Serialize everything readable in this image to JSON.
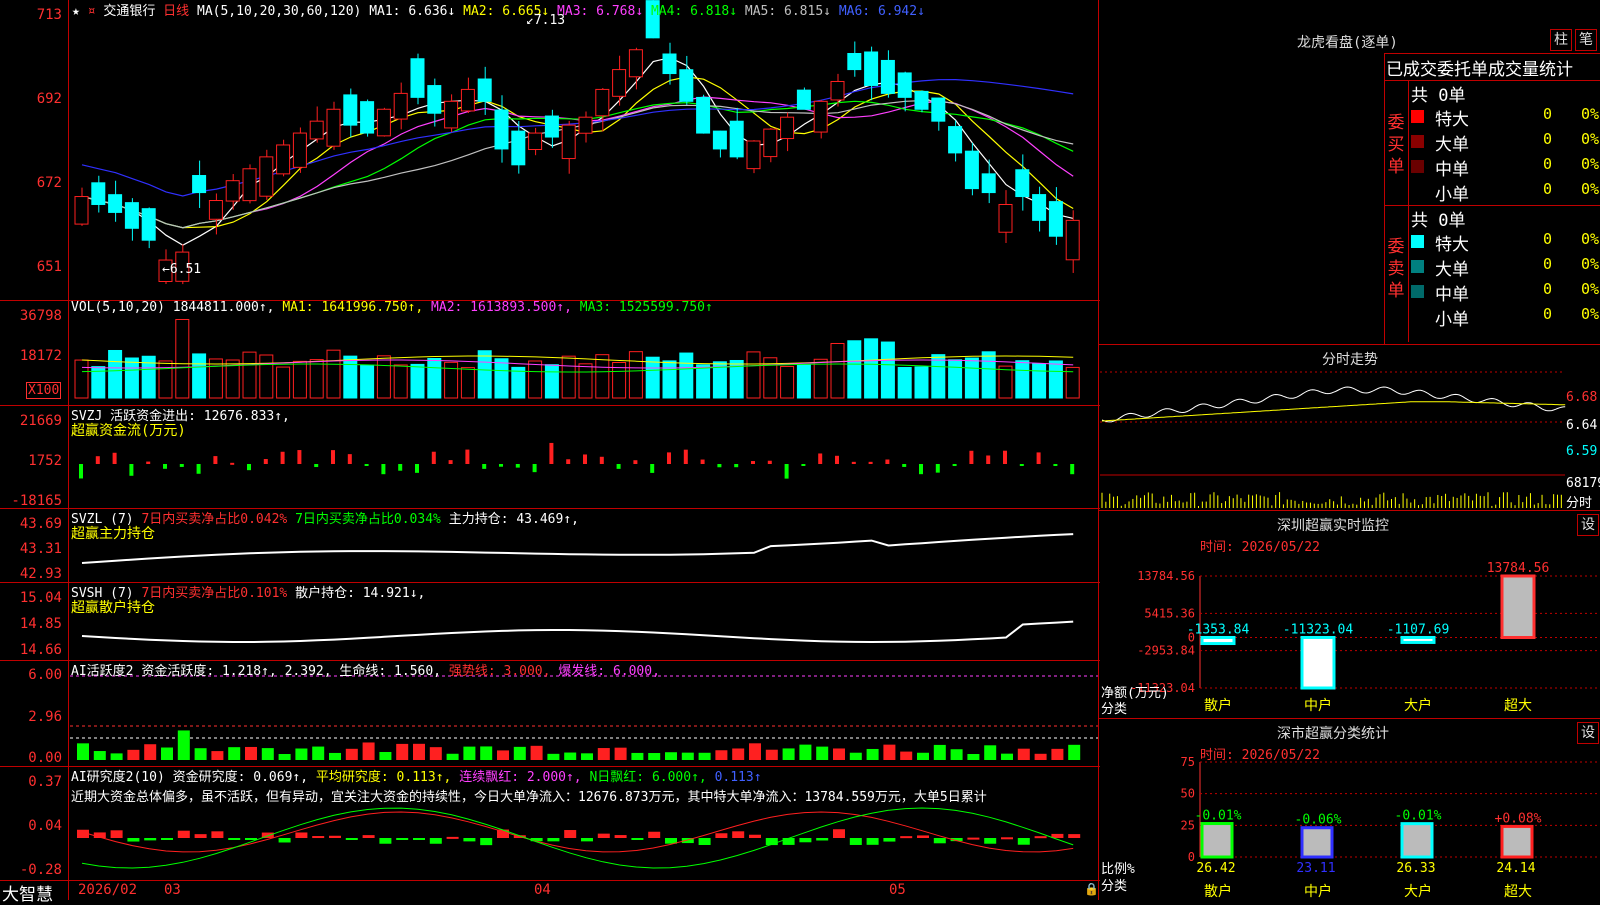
{
  "colors": {
    "up": "#ff2020",
    "down": "#00ffff",
    "bg": "#000000",
    "grid": "#c00000",
    "ma1": "#ffffff",
    "ma2": "#ffff00",
    "ma3": "#ff40ff",
    "ma4": "#00ff00",
    "ma5": "#c0c0c0",
    "ma6": "#3030ff"
  },
  "header": {
    "star": "★",
    "name": "交通银行",
    "period": "日线",
    "ma_label": "MA(5,10,20,30,60,120)",
    "ma1": "MA1: 6.636↓",
    "ma2": "MA2: 6.665↓",
    "ma3": "MA3: 6.768↓",
    "ma4": "MA4: 6.818↓",
    "ma5": "MA5: 6.815↓",
    "ma6": "MA6: 6.942↓"
  },
  "price_panel": {
    "y_ticks": [
      "713",
      "692",
      "672",
      "651"
    ],
    "high_label": "7.13",
    "low_label": "6.51"
  },
  "vol_panel": {
    "title": "VOL(5,10,20)",
    "value": "1844811.000↑,",
    "ma1": "MA1: 1641996.750↑,",
    "ma2": "MA2: 1613893.500↑,",
    "ma3": "MA3: 1525599.750↑",
    "y_ticks": [
      "36798",
      "18172"
    ],
    "unit": "X100"
  },
  "svzj_panel": {
    "title": "SVZJ",
    "line1": "活跃资金进出: 12676.833↑,",
    "line2": "超赢资金流(万元)",
    "y_ticks": [
      "21669",
      "1752",
      "-18165"
    ]
  },
  "svzl_panel": {
    "title": "SVZL (7)",
    "t1": "7日内买卖净占比0.042%",
    "t2": "7日内买卖净占比0.034%",
    "t3": "主力持仓: 43.469↑,",
    "line2": "超赢主力持仓",
    "y_ticks": [
      "43.69",
      "43.31",
      "42.93"
    ]
  },
  "svsh_panel": {
    "title": "SVSH (7)",
    "t1": "7日内买卖净占比0.101%",
    "t2": "散户持仓: 14.921↓,",
    "line2": "超赢散户持仓",
    "y_ticks": [
      "15.04",
      "14.85",
      "14.66"
    ]
  },
  "ai_active_panel": {
    "title": "AI活跃度2",
    "t1": "资金活跃度: 1.218↑,",
    "t2": "2.392,",
    "t3": "生命线: 1.560,",
    "t4": "强势线: 3.000,",
    "t5": "爆发线: 6.000,",
    "y_ticks": [
      "6.00",
      "2.96",
      "0.00"
    ]
  },
  "ai_research_panel": {
    "title": "AI研究度2(10)",
    "t1": "资金研究度: 0.069↑,",
    "t2": "平均研究度: 0.113↑,",
    "t3": "连续飘红: 2.000↑,",
    "t4": "N日飘红: 6.000↑,",
    "t5": "0.113↑",
    "note": "近期大资金总体偏多，虽不活跃，但有异动，宜关注大资金的持续性，今日大单净流入：12676.873万元，其中特大单净流入：13784.559万元，大单5日累计",
    "y_ticks": [
      "0.37",
      "0.04",
      "-0.28"
    ]
  },
  "x_axis": {
    "brand": "大智慧",
    "labels": [
      "2026/02",
      "03",
      "04",
      "05"
    ]
  },
  "lhb": {
    "title": "龙虎看盘(逐单)",
    "btn1": "柱",
    "btn2": "笔",
    "subtitle": "已成交委托单成交量统计",
    "buy_label": "委买单",
    "sell_label": "委卖单",
    "buy_total": "共 0单",
    "sell_total": "共 0单",
    "buy_rows": [
      {
        "label": "特大",
        "count": "0",
        "pct": "0%",
        "color": "#ff0000"
      },
      {
        "label": "大单",
        "count": "0",
        "pct": "0%",
        "color": "#8b0000"
      },
      {
        "label": "中单",
        "count": "0",
        "pct": "0%",
        "color": "#6a0000"
      },
      {
        "label": "小单",
        "count": "0",
        "pct": "0%",
        "color": "#000000"
      }
    ],
    "sell_rows": [
      {
        "label": "特大",
        "count": "0",
        "pct": "0%",
        "color": "#00ffff"
      },
      {
        "label": "大单",
        "count": "0",
        "pct": "0%",
        "color": "#008080"
      },
      {
        "label": "中单",
        "count": "0",
        "pct": "0%",
        "color": "#006a6a"
      },
      {
        "label": "小单",
        "count": "0",
        "pct": "0%",
        "color": "#000000"
      }
    ]
  },
  "intraday": {
    "title": "分时走势",
    "y_ticks": [
      "6.68",
      "6.64",
      "6.59"
    ],
    "vol_label": "68179",
    "vol_unit": "分时"
  },
  "monitor": {
    "title": "深圳超赢实时监控",
    "btn": "设",
    "time": "时间: 2026/05/22",
    "y_ticks": [
      "13784.56",
      "5415.36",
      "0",
      "-2953.84",
      "-11323.04"
    ],
    "ylabel1": "净额(万元)",
    "ylabel2": "分类",
    "chart_data": {
      "type": "bar",
      "categories": [
        "散户",
        "中户",
        "大户",
        "超大"
      ],
      "values": [
        -1353.84,
        -11323.04,
        -1107.69,
        13784.56
      ],
      "value_labels": [
        "-1353.84",
        "-11323.04",
        "-1107.69",
        "13784.56"
      ],
      "ylim": [
        -11323.04,
        13784.56
      ]
    }
  },
  "classify": {
    "title": "深市超赢分类统计",
    "btn": "设",
    "time": "时间: 2026/05/22",
    "y_ticks": [
      "75",
      "50",
      "25",
      "0"
    ],
    "ylabel1": "比例%",
    "ylabel2": "分类",
    "chart_data": {
      "type": "bar",
      "categories": [
        "散户",
        "中户",
        "大户",
        "超大"
      ],
      "values": [
        26.42,
        23.11,
        26.33,
        24.14
      ],
      "changes": [
        "-0.01%",
        "-0.06%",
        "-0.01%",
        "+0.08%"
      ],
      "ylim": [
        0,
        75
      ]
    }
  }
}
